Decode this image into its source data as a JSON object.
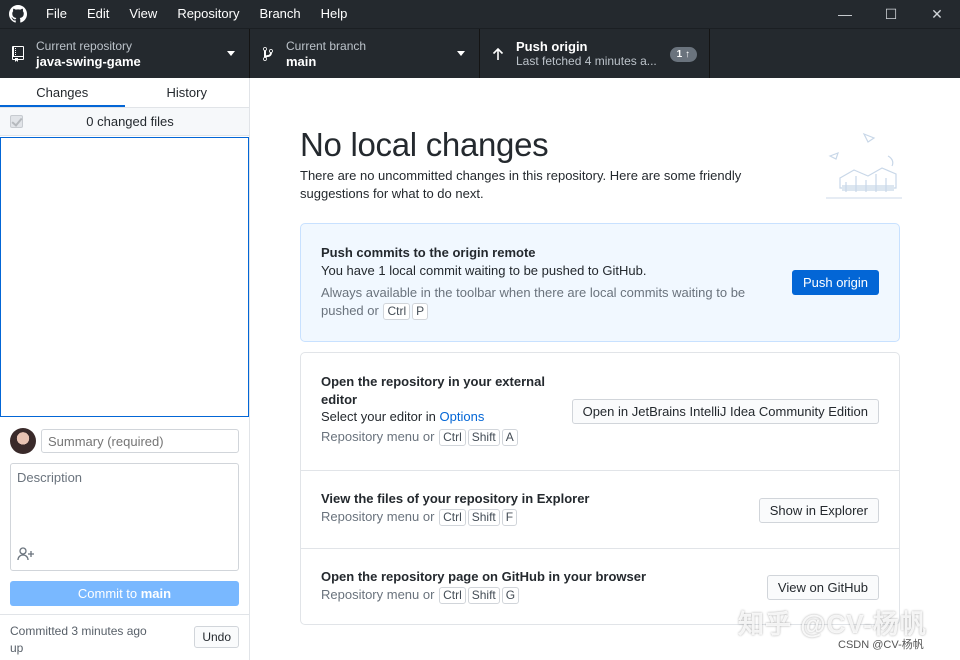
{
  "menu": {
    "items": [
      "File",
      "Edit",
      "View",
      "Repository",
      "Branch",
      "Help"
    ]
  },
  "window_controls": {
    "minimize": "—",
    "maximize": "☐",
    "close": "✕"
  },
  "toolbar": {
    "repo_label": "Current repository",
    "repo_value": "java-swing-game",
    "branch_label": "Current branch",
    "branch_value": "main",
    "push_title": "Push origin",
    "push_sub": "Last fetched 4 minutes a...",
    "push_badge": "1 ↑"
  },
  "sidebar": {
    "tabs": [
      "Changes",
      "History"
    ],
    "changed_files": "0 changed files",
    "summary_placeholder": "Summary (required)",
    "description_placeholder": "Description",
    "commit_prefix": "Commit to ",
    "commit_branch": "main",
    "undo_text": "Committed 3 minutes ago",
    "undo_text2": "up",
    "undo_button": "Undo"
  },
  "main": {
    "heading": "No local changes",
    "intro": "There are no uncommitted changes in this repository. Here are some friendly suggestions for what to do next.",
    "push_card": {
      "title": "Push commits to the origin remote",
      "desc": "You have 1 local commit waiting to be pushed to GitHub.",
      "hint": "Always available in the toolbar when there are local commits waiting to be pushed or",
      "keys": [
        "Ctrl",
        "P"
      ],
      "button": "Push origin"
    },
    "editor_card": {
      "title": "Open the repository in your external editor",
      "desc_prefix": "Select your editor in ",
      "desc_link": "Options",
      "hint": "Repository menu or",
      "keys": [
        "Ctrl",
        "Shift",
        "A"
      ],
      "button": "Open in JetBrains IntelliJ Idea Community Edition"
    },
    "explorer_card": {
      "title": "View the files of your repository in Explorer",
      "hint": "Repository menu or",
      "keys": [
        "Ctrl",
        "Shift",
        "F"
      ],
      "button": "Show in Explorer"
    },
    "github_card": {
      "title": "Open the repository page on GitHub in your browser",
      "hint": "Repository menu or",
      "keys": [
        "Ctrl",
        "Shift",
        "G"
      ],
      "button": "View on GitHub"
    }
  },
  "watermark": {
    "main": "知乎 @CV-杨帆",
    "sub": "CSDN @CV-杨帆"
  }
}
